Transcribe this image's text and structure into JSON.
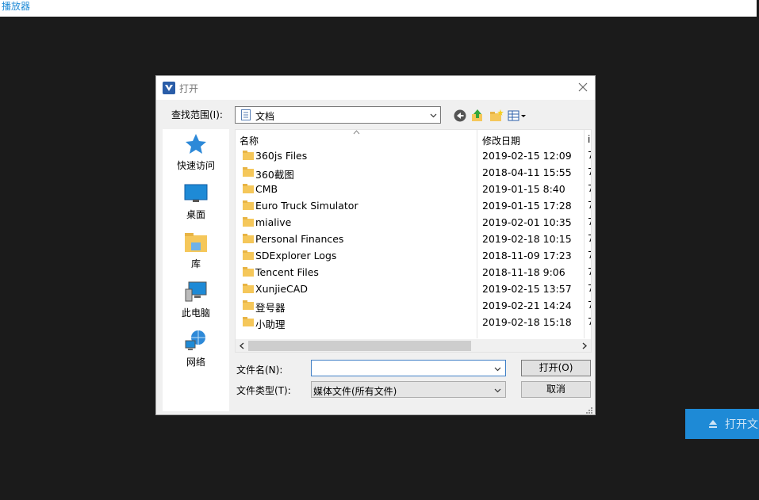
{
  "app": {
    "title": "播放器"
  },
  "open_file_button": {
    "label": "打开文"
  },
  "dialog": {
    "title": "打开",
    "look_in": {
      "label": "查找范围(I):",
      "value": "文档"
    },
    "places": [
      {
        "label": "快速访问",
        "icon": "star-icon"
      },
      {
        "label": "桌面",
        "icon": "desktop-icon"
      },
      {
        "label": "库",
        "icon": "library-icon"
      },
      {
        "label": "此电脑",
        "icon": "computer-icon"
      },
      {
        "label": "网络",
        "icon": "network-icon"
      }
    ],
    "columns": {
      "name": "名称",
      "date": "修改日期",
      "next": "i"
    },
    "files": [
      {
        "name": "360js Files",
        "date": "2019-02-15 12:09",
        "next": "7"
      },
      {
        "name": "360截图",
        "date": "2018-04-11 15:55",
        "next": "7"
      },
      {
        "name": "CMB",
        "date": "2019-01-15 8:40",
        "next": "7"
      },
      {
        "name": "Euro Truck Simulator",
        "date": "2019-01-15 17:28",
        "next": "7"
      },
      {
        "name": "mialive",
        "date": "2019-02-01 10:35",
        "next": "7"
      },
      {
        "name": "Personal Finances",
        "date": "2019-02-18 10:15",
        "next": "7"
      },
      {
        "name": "SDExplorer Logs",
        "date": "2018-11-09 17:23",
        "next": "7"
      },
      {
        "name": "Tencent Files",
        "date": "2018-11-18 9:06",
        "next": "7"
      },
      {
        "name": "XunjieCAD",
        "date": "2019-02-15 13:57",
        "next": "7"
      },
      {
        "name": "登号器",
        "date": "2019-02-21 14:24",
        "next": "7"
      },
      {
        "name": "小助理",
        "date": "2019-02-18 15:18",
        "next": "7"
      }
    ],
    "filename": {
      "label": "文件名(N):",
      "value": ""
    },
    "filetype": {
      "label": "文件类型(T):",
      "value": "媒体文件(所有文件)"
    },
    "open_button": "打开(O)",
    "cancel_button": "取消"
  },
  "colors": {
    "accent": "#1e8ad6",
    "background": "#1b1b1b",
    "folder": "#f5c75a"
  }
}
